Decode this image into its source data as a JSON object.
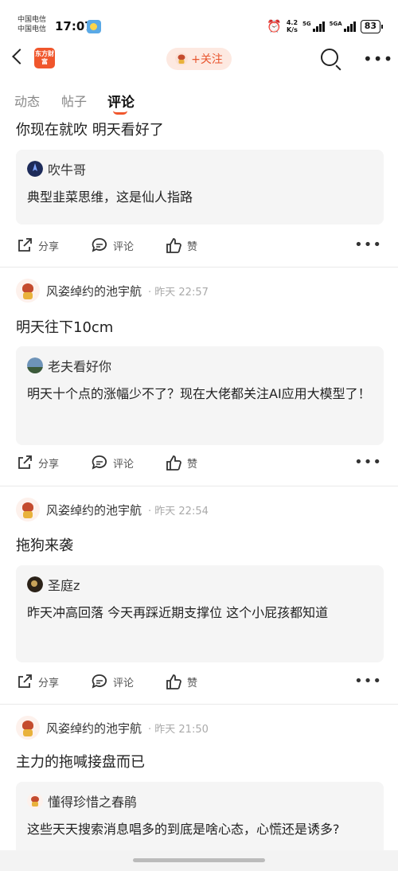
{
  "status_bar": {
    "carrier_1": "中国电信",
    "carrier_2": "中国电信",
    "time": "17:07",
    "net_speed_value": "4.2",
    "net_speed_unit": "K/s",
    "signal_1": "5G",
    "signal_2": "5GA",
    "battery": "83"
  },
  "nav": {
    "logo_text": "东方财富",
    "follow_label": "+关注"
  },
  "tabs": [
    {
      "label": "动态"
    },
    {
      "label": "帖子"
    },
    {
      "label": "评论"
    }
  ],
  "active_tab": "评论",
  "posts": [
    {
      "text": "你现在就吹 明天看好了",
      "quote": {
        "author": "吹牛哥",
        "text": "典型韭菜思维，这是仙人指路"
      }
    },
    {
      "author": "风姿绰约的池宇航",
      "time": "· 昨天 22:57",
      "text": "明天往下10cm",
      "quote": {
        "author": "老夫看好你",
        "text": "明天十个点的涨幅少不了？现在大佬都关注AI应用大模型了！"
      }
    },
    {
      "author": "风姿绰约的池宇航",
      "time": "· 昨天 22:54",
      "text": "拖狗来袭",
      "quote": {
        "author": "圣庭z",
        "text": "昨天冲高回落 今天再踩近期支撑位 这个小屁孩都知道"
      }
    },
    {
      "author": "风姿绰约的池宇航",
      "time": "· 昨天 21:50",
      "text": "主力的拖喊接盘而已",
      "quote": {
        "author": "懂得珍惜之春鹃",
        "text": "这些天天搜索消息唱多的到底是啥心态，心慌还是诱多?"
      }
    }
  ],
  "actions": {
    "share": "分享",
    "comment": "评论",
    "like": "赞"
  },
  "colors": {
    "accent": "#f0562c",
    "quote_bg": "#f5f5f5"
  }
}
